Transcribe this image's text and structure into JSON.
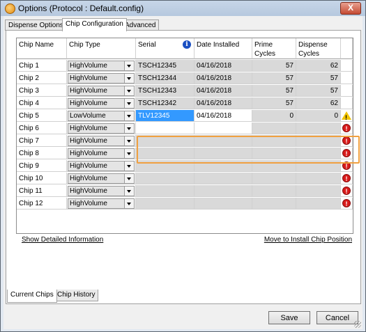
{
  "window": {
    "title": "Options (Protocol : Default.config)",
    "close_label": "X"
  },
  "tabs": [
    {
      "label": "Dispense Options",
      "active": false
    },
    {
      "label": "Chip Configuration",
      "active": true
    },
    {
      "label": "Advanced",
      "active": false
    }
  ],
  "grid": {
    "columns": [
      "Chip Name",
      "Chip Type",
      "Serial",
      "Date Installed",
      "Prime\nCycles",
      "Dispense\nCycles",
      ""
    ],
    "info_icon": "i",
    "rows": [
      {
        "name": "Chip 1",
        "type": "HighVolume",
        "serial": "TSCH12345",
        "date": "04/16/2018",
        "prime": "57",
        "dispense": "62",
        "status": ""
      },
      {
        "name": "Chip 2",
        "type": "HighVolume",
        "serial": "TSCH12344",
        "date": "04/16/2018",
        "prime": "57",
        "dispense": "57",
        "status": ""
      },
      {
        "name": "Chip 3",
        "type": "HighVolume",
        "serial": "TSCH12343",
        "date": "04/16/2018",
        "prime": "57",
        "dispense": "57",
        "status": ""
      },
      {
        "name": "Chip 4",
        "type": "HighVolume",
        "serial": "TSCH12342",
        "date": "04/16/2018",
        "prime": "57",
        "dispense": "62",
        "status": ""
      },
      {
        "name": "Chip 5",
        "type": "LowVolume",
        "serial": "TLV12345",
        "date": "04/16/2018",
        "prime": "0",
        "dispense": "0",
        "status": "warning"
      },
      {
        "name": "Chip 6",
        "type": "HighVolume",
        "serial": "",
        "date": "",
        "prime": "",
        "dispense": "",
        "status": "error"
      },
      {
        "name": "Chip 7",
        "type": "HighVolume",
        "serial": "",
        "date": "",
        "prime": "",
        "dispense": "",
        "status": "error"
      },
      {
        "name": "Chip 8",
        "type": "HighVolume",
        "serial": "",
        "date": "",
        "prime": "",
        "dispense": "",
        "status": "error"
      },
      {
        "name": "Chip 9",
        "type": "HighVolume",
        "serial": "",
        "date": "",
        "prime": "",
        "dispense": "",
        "status": "error"
      },
      {
        "name": "Chip 10",
        "type": "HighVolume",
        "serial": "",
        "date": "",
        "prime": "",
        "dispense": "",
        "status": "error"
      },
      {
        "name": "Chip 11",
        "type": "HighVolume",
        "serial": "",
        "date": "",
        "prime": "",
        "dispense": "",
        "status": "error"
      },
      {
        "name": "Chip 12",
        "type": "HighVolume",
        "serial": "",
        "date": "",
        "prime": "",
        "dispense": "",
        "status": "error"
      }
    ],
    "status_glyph_error": "!"
  },
  "links": {
    "show_detailed": "Show Detailed Information",
    "move_to_install": "Move to Install Chip Position"
  },
  "bottom_tabs": [
    {
      "label": "Current Chips",
      "active": true
    },
    {
      "label": "Chip History",
      "active": false
    }
  ],
  "buttons": {
    "save": "Save",
    "cancel": "Cancel"
  },
  "colors": {
    "selection": "#3399ff",
    "highlight_border": "#f0a040",
    "error": "#d81b1b",
    "warning": "#f2c400",
    "info": "#1a4fc2"
  }
}
